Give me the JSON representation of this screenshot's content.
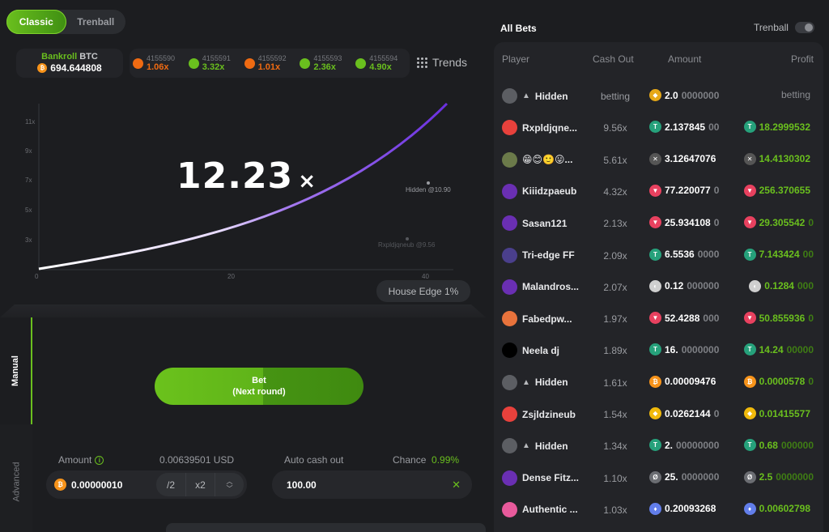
{
  "mode_tabs": [
    "Classic",
    "Trenball"
  ],
  "bankroll": {
    "label_green": "Bankroll",
    "label_currency": "BTC",
    "value": "694.644808"
  },
  "history": [
    {
      "id": "4155590",
      "mult": "1.06x",
      "color": "#ef6a12"
    },
    {
      "id": "4155591",
      "mult": "3.32x",
      "color": "#6abf1e"
    },
    {
      "id": "4155592",
      "mult": "1.01x",
      "color": "#ef6a12"
    },
    {
      "id": "4155593",
      "mult": "2.36x",
      "color": "#6abf1e"
    },
    {
      "id": "4155594",
      "mult": "4.90x",
      "color": "#6abf1e"
    }
  ],
  "trends_label": "Trends",
  "game": {
    "multiplier": "12.23",
    "multiplier_suffix": "×",
    "y_ticks": [
      "11x",
      "9x",
      "7x",
      "5x",
      "3x"
    ],
    "x_ticks": [
      "0",
      "20",
      "40"
    ],
    "markers": [
      {
        "label": "Hidden @10.90"
      },
      {
        "label": "Rxpldjqneub @9.56"
      }
    ],
    "house_edge": "House Edge 1%"
  },
  "side_tabs": {
    "manual": "Manual",
    "advanced": "Advanced"
  },
  "bet_button": {
    "line1": "Bet",
    "line2": "(Next round)"
  },
  "amount": {
    "label": "Amount",
    "usd": "0.00639501 USD",
    "value": "0.00000010",
    "half": "/2",
    "double": "x2"
  },
  "auto_cashout": {
    "label": "Auto cash out",
    "value": "100.00",
    "chance_label": "Chance",
    "chance_value": "0.99%"
  },
  "bets": {
    "title": "All Bets",
    "trenball_label": "Trenball",
    "headers": {
      "player": "Player",
      "cashout": "Cash Out",
      "amount": "Amount",
      "profit": "Profit"
    },
    "rows": [
      {
        "player": "Hidden",
        "hidden": true,
        "avatar": "#5c5e63",
        "cash": "betting",
        "coin": "#e6a817",
        "coin_sym": "◆",
        "amt": "2.0",
        "amt_dim": "0000000",
        "profit": "betting",
        "profit_dim": "",
        "neutral": true,
        "pcoin": ""
      },
      {
        "player": "Rxpldjqne...",
        "avatar": "#e8413c",
        "cash": "9.56x",
        "coin": "#26a17b",
        "coin_sym": "T",
        "amt": "2.137845",
        "amt_dim": "00",
        "profit": "18.2999532",
        "profit_dim": "",
        "pcoin": "#26a17b",
        "pcoin_sym": "T"
      },
      {
        "player": "😁😊🙂😛...",
        "avatar": "#6b7a4a",
        "cash": "5.61x",
        "coin": "#555",
        "coin_sym": "✕",
        "amt": "3.12647076",
        "amt_dim": "",
        "profit": "14.4130302",
        "profit_dim": "",
        "pcoin": "#555",
        "pcoin_sym": "✕"
      },
      {
        "player": "Kiiidzpaeub",
        "avatar": "#6a2fb3",
        "cash": "4.32x",
        "coin": "#e8415f",
        "coin_sym": "▼",
        "amt": "77.220077",
        "amt_dim": "0",
        "profit": "256.370655",
        "profit_dim": "",
        "pcoin": "#e8415f",
        "pcoin_sym": "▼"
      },
      {
        "player": "Sasan121",
        "avatar": "#6a2fb3",
        "cash": "2.13x",
        "coin": "#e8415f",
        "coin_sym": "▼",
        "amt": "25.934108",
        "amt_dim": "0",
        "profit": "29.305542",
        "profit_dim": "0",
        "pcoin": "#e8415f",
        "pcoin_sym": "▼"
      },
      {
        "player": "Tri-edge FF",
        "avatar": "#4a3f8c",
        "cash": "2.09x",
        "coin": "#26a17b",
        "coin_sym": "T",
        "amt": "6.5536",
        "amt_dim": "0000",
        "profit": "7.143424",
        "profit_dim": "00",
        "pcoin": "#26a17b",
        "pcoin_sym": "T"
      },
      {
        "player": "Malandros...",
        "avatar": "#6a2fb3",
        "cash": "2.07x",
        "coin": "#cfcfcf",
        "coin_sym": "◐",
        "amt": "0.12",
        "amt_dim": "000000",
        "profit": "0.1284",
        "profit_dim": "000",
        "pcoin": "#cfcfcf",
        "pcoin_sym": "◐"
      },
      {
        "player": "Fabedpw...",
        "avatar": "#e8733c",
        "cash": "1.97x",
        "coin": "#e8415f",
        "coin_sym": "▼",
        "amt": "52.4288",
        "amt_dim": "000",
        "profit": "50.855936",
        "profit_dim": "0",
        "pcoin": "#e8415f",
        "pcoin_sym": "▼"
      },
      {
        "player": "Neela dj",
        "avatar": "#000000",
        "cash": "1.89x",
        "coin": "#26a17b",
        "coin_sym": "T",
        "amt": "16.",
        "amt_dim": "0000000",
        "profit": "14.24",
        "profit_dim": "00000",
        "pcoin": "#26a17b",
        "pcoin_sym": "T"
      },
      {
        "player": "Hidden",
        "hidden": true,
        "avatar": "#5c5e63",
        "cash": "1.61x",
        "coin": "#f7931a",
        "coin_sym": "₿",
        "amt": "0.00009476",
        "amt_dim": "",
        "profit": "0.0000578",
        "profit_dim": "0",
        "pcoin": "#f7931a",
        "pcoin_sym": "₿"
      },
      {
        "player": "Zsjldzineub",
        "avatar": "#e8413c",
        "cash": "1.54x",
        "coin": "#f0b90b",
        "coin_sym": "◆",
        "amt": "0.0262144",
        "amt_dim": "0",
        "profit": "0.01415577",
        "profit_dim": "",
        "pcoin": "#f0b90b",
        "pcoin_sym": "◆"
      },
      {
        "player": "Hidden",
        "hidden": true,
        "avatar": "#5c5e63",
        "cash": "1.34x",
        "coin": "#26a17b",
        "coin_sym": "T",
        "amt": "2.",
        "amt_dim": "00000000",
        "profit": "0.68",
        "profit_dim": "000000",
        "pcoin": "#26a17b",
        "pcoin_sym": "T"
      },
      {
        "player": "Dense Fitz...",
        "avatar": "#6a2fb3",
        "cash": "1.10x",
        "coin": "#6b6d72",
        "coin_sym": "Ø",
        "amt": "25.",
        "amt_dim": "0000000",
        "profit": "2.5",
        "profit_dim": "0000000",
        "pcoin": "#6b6d72",
        "pcoin_sym": "Ø"
      },
      {
        "player": "Authentic ...",
        "avatar": "#e85a9c",
        "cash": "1.03x",
        "coin": "#627eea",
        "coin_sym": "♦",
        "amt": "0.20093268",
        "amt_dim": "",
        "profit": "0.00602798",
        "profit_dim": "",
        "pcoin": "#627eea",
        "pcoin_sym": "♦"
      }
    ]
  }
}
